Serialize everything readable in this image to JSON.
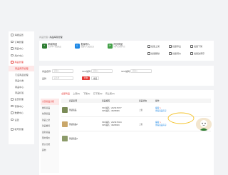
{
  "sidebar": {
    "items": [
      {
        "label": "海报设置"
      },
      {
        "label": "订单管理"
      },
      {
        "label": "商品中心"
      },
      {
        "label": "用户中心"
      },
      {
        "label": "商品管理",
        "active": true
      },
      {
        "label": "商品库存管理",
        "sub": true,
        "selected": true
      },
      {
        "label": "门店商品管理",
        "sub": true
      },
      {
        "label": "商品分类",
        "sub": true
      },
      {
        "label": "商品中心",
        "sub": true
      },
      {
        "label": "商品标签",
        "sub": true
      },
      {
        "label": "会员管理"
      },
      {
        "label": "营销中心"
      },
      {
        "label": "数据中心"
      },
      {
        "label": "设置"
      },
      {
        "label": "帐号管理"
      }
    ]
  },
  "breadcrumb": {
    "parent": "商品管理",
    "sep": " / ",
    "current": "商品库存管理"
  },
  "toolbar": {
    "tools": [
      {
        "title": "新增商品",
        "desc": "支持单个添加商品",
        "color": "#2e7d32",
        "icon": "plus-icon"
      },
      {
        "title": "批量导入",
        "desc": "批量导入商品信息",
        "color": "#1e88e5",
        "icon": "import-icon"
      },
      {
        "title": "同步商品",
        "desc": "同步至其他平台",
        "color": "#43a047",
        "icon": "sync-icon"
      }
    ],
    "small": [
      "批量上架",
      "批量导出",
      "批量下架",
      "批量删除",
      "批量调价",
      "批量改库存"
    ]
  },
  "filter": {
    "name_label": "商品名称",
    "name_placeholder": "请输入",
    "sku_label": "SKU编码",
    "sku_placeholder": "请输入",
    "spu_label": "SPU编码",
    "spu_placeholder": "请输入",
    "brand_label": "品牌",
    "brand_placeholder": "请选择",
    "query_label": "查询",
    "reset_label": "重置"
  },
  "tabs": [
    "全部商品",
    "上架(2)",
    "下架(0)",
    "已下架(0)",
    "待上架(0)"
  ],
  "groups": [
    "全部商品分组",
    "推荐商品",
    "热销商品",
    "新品上架",
    "新品推荐",
    "最新商品",
    "限时特价",
    "默认分组",
    "其他"
  ],
  "table": {
    "headers": [
      "商品名称",
      "商品编码",
      "商品状态",
      "操作"
    ],
    "rows": [
      {
        "name": "测试商品",
        "sku": "SKU编码：2023470077",
        "spu": "SPU编码：38208989",
        "status": "上架",
        "op1": "编辑",
        "op2": "查看商品库存"
      },
      {
        "name": "测试商品2",
        "sku": "SKU编码：2023470044",
        "spu": "SPU编码：38208969",
        "status": "上架",
        "op1": "编辑",
        "op2": "查看商品库存"
      },
      {
        "name": "测试商品3",
        "sku": "",
        "spu": "",
        "status": "",
        "op1": "",
        "op2": ""
      }
    ]
  }
}
